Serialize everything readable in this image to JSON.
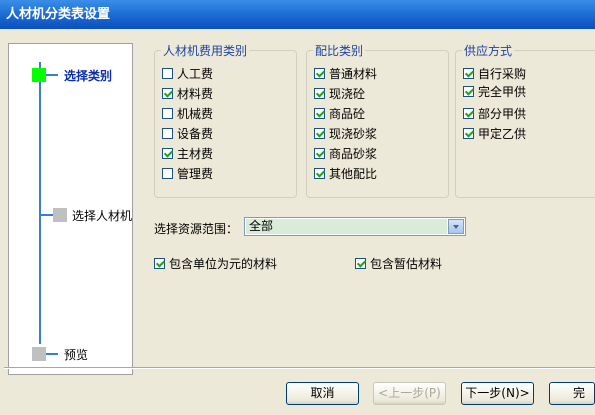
{
  "window": {
    "title": "人材机分类表设置"
  },
  "steps": [
    {
      "label": "选择类别",
      "active": true
    },
    {
      "label": "选择人材机",
      "active": false
    },
    {
      "label": "预览",
      "active": false
    }
  ],
  "colors": {
    "active_marker": "#00ff00",
    "inactive_marker": "#c0c0c0",
    "line": "#3a7ecf"
  },
  "groups": [
    {
      "title": "人材机费用类别",
      "items": [
        {
          "label": "人工费",
          "checked": false
        },
        {
          "label": "材料费",
          "checked": true
        },
        {
          "label": "机械费",
          "checked": false
        },
        {
          "label": "设备费",
          "checked": false
        },
        {
          "label": "主材费",
          "checked": true
        },
        {
          "label": "管理费",
          "checked": false
        }
      ]
    },
    {
      "title": "配比类别",
      "items": [
        {
          "label": "普通材料",
          "checked": true
        },
        {
          "label": "现浇砼",
          "checked": true
        },
        {
          "label": "商品砼",
          "checked": true
        },
        {
          "label": "现浇砂浆",
          "checked": true
        },
        {
          "label": "商品砂浆",
          "checked": true
        },
        {
          "label": "其他配比",
          "checked": true
        }
      ]
    },
    {
      "title": "供应方式",
      "items": [
        {
          "label": "自行采购",
          "checked": true
        },
        {
          "label": "完全甲供",
          "checked": true
        },
        {
          "label": "部分甲供",
          "checked": true
        },
        {
          "label": "甲定乙供",
          "checked": true
        }
      ]
    }
  ],
  "range": {
    "label": "选择资源范围：",
    "value": "全部"
  },
  "options": [
    {
      "label": "包含单位为元的材料",
      "checked": true
    },
    {
      "label": "包含暂估材料",
      "checked": true
    }
  ],
  "buttons": {
    "cancel": "取消",
    "prev": "<上一步(P)",
    "next": "下一步(N)>",
    "finish": "完成"
  }
}
